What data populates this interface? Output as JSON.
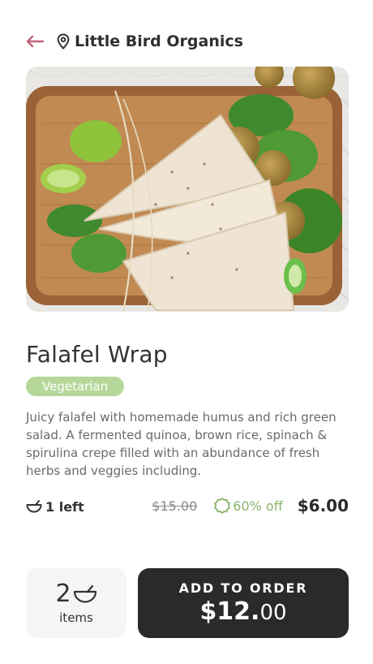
{
  "header": {
    "store_name": "Little Bird Organics",
    "back_icon": "arrow-left-icon",
    "location_icon": "map-pin-icon",
    "accent_color": "#c6617a"
  },
  "product": {
    "image_alt": "Falafel wraps on a wooden board",
    "title": "Falafel Wrap",
    "badge": "Vegetarian",
    "badge_color": "#b5d89a",
    "description": "Juicy falafel with homemade humus and rich green salad. A fermented quinoa, brown rice, spinach & spirulina crepe filled with an abundance of fresh herbs and veggies including.",
    "stock_label": "1 left",
    "original_price": "$15.00",
    "discount_label": "60% off",
    "discount_color": "#8bb36a",
    "price": "$6.00"
  },
  "order": {
    "quantity": "2",
    "quantity_label": "items",
    "add_label": "ADD TO ORDER",
    "total_dollars": "$12.",
    "total_cents": "00"
  }
}
